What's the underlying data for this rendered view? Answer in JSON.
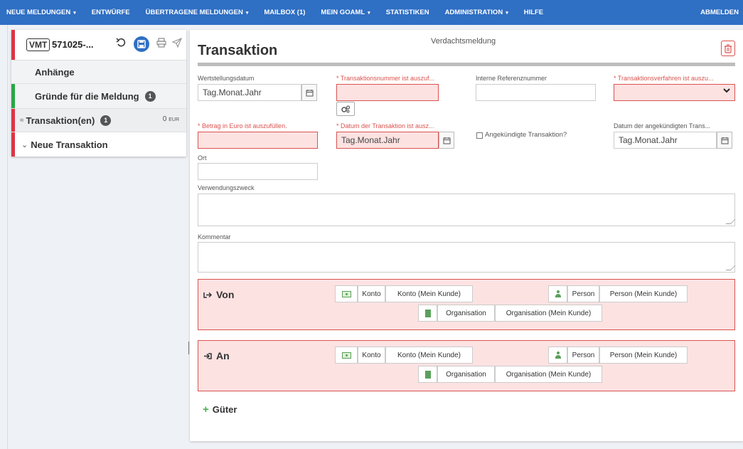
{
  "nav": {
    "items": [
      {
        "label": "NEUE MELDUNGEN",
        "dropdown": true
      },
      {
        "label": "ENTWÜRFE",
        "dropdown": false
      },
      {
        "label": "ÜBERTRAGENE MELDUNGEN",
        "dropdown": true
      },
      {
        "label": "MAILBOX (1)",
        "dropdown": false
      },
      {
        "label": "MEIN GOAML",
        "dropdown": true
      },
      {
        "label": "STATISTIKEN",
        "dropdown": false
      },
      {
        "label": "ADMINISTRATION",
        "dropdown": true
      },
      {
        "label": "HILFE",
        "dropdown": false
      }
    ],
    "logout": "ABMELDEN",
    "caret": "▾"
  },
  "sidebar": {
    "badge": "VMT",
    "reference": "571025-...",
    "items": [
      {
        "label": "Anhänge"
      },
      {
        "label": "Gründe für die Meldung",
        "count": "1"
      },
      {
        "label": "Transaktion(en)",
        "count": "1",
        "amount": "0",
        "currency": "EUR",
        "prefix": "≈"
      },
      {
        "label": "Neue Transaktion",
        "prefix": "⌄"
      }
    ]
  },
  "main": {
    "header_label": "Verdachtsmeldung",
    "title": "Transaktion",
    "fields": {
      "wertstellungsdatum": {
        "label": "Wertstellungsdatum",
        "placeholder": "Tag.Monat.Jahr"
      },
      "transaktionsnummer": {
        "label": "* Transaktionsnummer ist auszuf..."
      },
      "interne_referenz": {
        "label": "Interne Referenznummer"
      },
      "transaktionsverfahren": {
        "label": "* Transaktionsverfahren ist auszu..."
      },
      "betrag": {
        "label": "* Betrag in Euro ist auszufüllen."
      },
      "datum_transaktion": {
        "label": "* Datum der Transaktion ist ausz...",
        "placeholder": "Tag.Monat.Jahr"
      },
      "angekuendigt": {
        "label": "Angekündigte Transaktion?"
      },
      "datum_angekuendigt": {
        "label": "Datum der angekündigten Trans...",
        "placeholder": "Tag.Monat.Jahr"
      },
      "ort": {
        "label": "Ort"
      },
      "verwendungszweck": {
        "label": "Verwendungszweck"
      },
      "kommentar": {
        "label": "Kommentar"
      }
    },
    "parties": [
      {
        "title": "Von",
        "icon": "sign-out-icon"
      },
      {
        "title": "An",
        "icon": "sign-in-icon"
      }
    ],
    "party_buttons": {
      "konto": "Konto",
      "konto_kunde": "Konto (Mein Kunde)",
      "person": "Person",
      "person_kunde": "Person (Mein Kunde)",
      "organisation": "Organisation",
      "organisation_kunde": "Organisation (Mein Kunde)"
    },
    "goods": "Güter"
  },
  "colors": {
    "nav_bg": "#2f6fc4",
    "error_bg": "#fde2e2",
    "error_border": "#d9534f",
    "status_red": "#dc3545",
    "status_green": "#28a745",
    "icon_green": "#5aa05a"
  }
}
